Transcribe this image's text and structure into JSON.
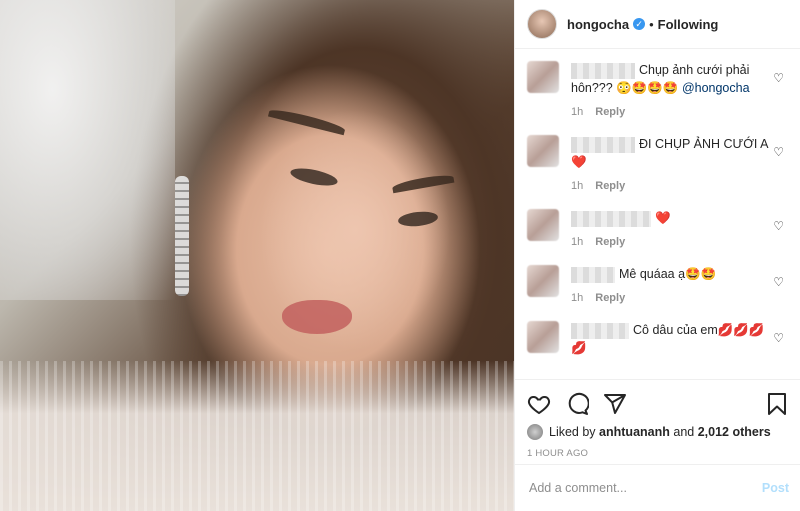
{
  "post": {
    "photo_alt_icon": "selfie-photo"
  },
  "header": {
    "username": "hongocha",
    "verified_icon": "verified-badge-icon",
    "separator": "•",
    "follow_status": "Following"
  },
  "comments": [
    {
      "username": "anhtuananh",
      "text": "Chụp ảnh cưới phải hôn??? 😳🤩🤩🤩",
      "mention": "@hongocha",
      "time": "1h",
      "reply_label": "Reply"
    },
    {
      "username": "",
      "text": "ĐI CHỤP ẢNH CƯỚI A ❤️",
      "mention": "",
      "time": "1h",
      "reply_label": "Reply"
    },
    {
      "username": "",
      "text": "❤️",
      "mention": "",
      "time": "1h",
      "reply_label": "Reply"
    },
    {
      "username": "",
      "text": "Mê quáaa ạ🤩🤩",
      "mention": "",
      "time": "1h",
      "reply_label": "Reply"
    },
    {
      "username": "",
      "text": "Cô dâu của em💋💋💋💋",
      "mention": "",
      "time": "",
      "reply_label": ""
    }
  ],
  "actions": {
    "like_icon": "heart-icon",
    "comment_icon": "comment-icon",
    "share_icon": "share-icon",
    "save_icon": "bookmark-icon"
  },
  "likes": {
    "prefix": "Liked by",
    "user": "anhtuananh",
    "and": "and",
    "others": "2,012 others"
  },
  "timestamp": "1 hour ago",
  "add_comment": {
    "placeholder": "Add a comment...",
    "post_label": "Post"
  }
}
